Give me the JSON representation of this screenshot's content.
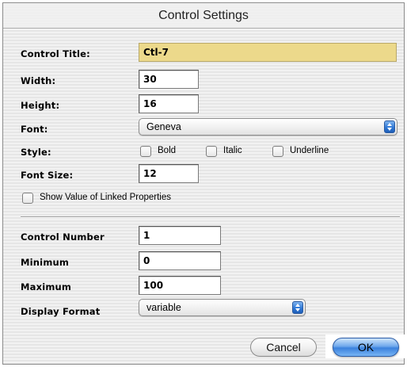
{
  "window": {
    "title": "Control Settings"
  },
  "form": {
    "control_title": {
      "label": "Control Title:",
      "value": "Ctl-7"
    },
    "width": {
      "label": "Width:",
      "value": "30"
    },
    "height": {
      "label": "Height:",
      "value": "16"
    },
    "font": {
      "label": "Font:",
      "value": "Geneva"
    },
    "style": {
      "label": "Style:",
      "options": [
        {
          "label": "Bold",
          "checked": false
        },
        {
          "label": "Italic",
          "checked": false
        },
        {
          "label": "Underline",
          "checked": false
        }
      ]
    },
    "font_size": {
      "label": "Font Size:",
      "value": "12"
    },
    "show_linked": {
      "label": "Show Value of Linked Properties",
      "checked": false
    },
    "control_number": {
      "label": "Control Number",
      "value": "1"
    },
    "minimum": {
      "label": "Minimum",
      "value": "0"
    },
    "maximum": {
      "label": "Maximum",
      "value": "100"
    },
    "display_format": {
      "label": "Display Format",
      "value": "variable"
    }
  },
  "buttons": {
    "cancel": "Cancel",
    "ok": "OK"
  },
  "colors": {
    "active_field": "#ecd98b",
    "default_button": "#3b82dd",
    "popup_arrows": "#2f78d6"
  }
}
